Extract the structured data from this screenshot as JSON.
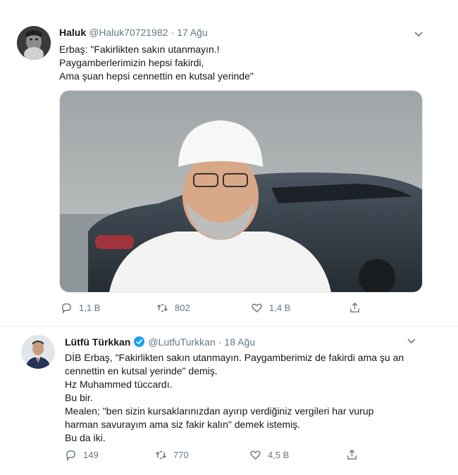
{
  "tweet1": {
    "name": "Haluk",
    "handle": "@Haluk70721982",
    "dot": "·",
    "date": "17 Ağu",
    "lines": [
      "Erbaş:  \"Fakirlikten sakın utanmayın.!",
      "Paygamberlerimizin hepsi fakirdi,",
      "Ama şuan hepsi cennettin en kutsal yerinde\""
    ],
    "stats": {
      "replies": "1,1 B",
      "retweets": "802",
      "likes": "1,4 B"
    },
    "icons": {
      "avatar": "avatar-dark-portrait",
      "menu": "chevron-down-icon"
    }
  },
  "tweet2": {
    "name": "Lütfü Türkkan",
    "handle": "@LutfuTurkkan",
    "dot": "·",
    "date": "18 Ağu",
    "lines": [
      "DİB Erbaş, \"Fakirlikten sakın utanmayın. Paygamberimiz de fakirdi ama şu an",
      "cennettin en kutsal yerinde\" demiş.",
      "Hz Muhammed tüccardı.",
      "Bu bir.",
      "Mealen; \"ben sizin kursaklarınızdan ayırıp verdiğiniz vergileri har vurup",
      "harman savurayım ama siz fakir kalın\" demek istemiş.",
      "Bu da iki."
    ],
    "stats": {
      "replies": "149",
      "retweets": "770",
      "likes": "4,5 B"
    },
    "icons": {
      "verified": "verified-badge-icon",
      "menu": "chevron-down-icon"
    }
  },
  "colors": {
    "text": "#14171a",
    "meta": "#657786",
    "verified": "#1da1f2"
  }
}
